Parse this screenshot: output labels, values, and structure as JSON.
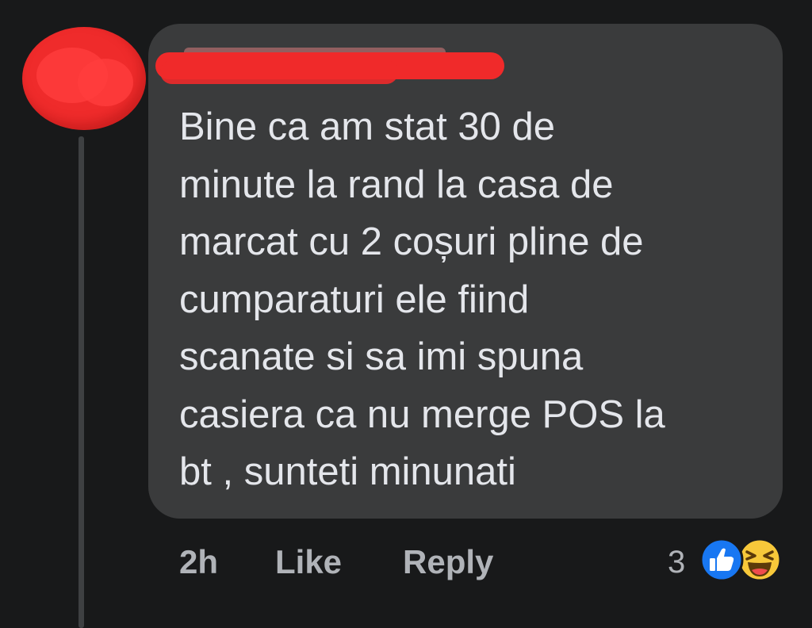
{
  "comment": {
    "author_name": "",
    "text": "Bine ca am stat 30 de\nminute la rand la casa de\nmarcat cu 2 coșuri pline de\ncumparaturi ele fiind\nscanate si sa imi spuna\ncasiera ca nu merge POS la\nbt , sunteti minunati",
    "timestamp": "2h",
    "like_label": "Like",
    "reply_label": "Reply",
    "reaction_count": "3",
    "reactions": [
      "like-icon",
      "haha-icon"
    ]
  },
  "colors": {
    "background": "#18191a",
    "bubble": "#3a3b3c",
    "text": "#e4e6eb",
    "secondary_text": "#b0b3b8",
    "redaction": "#f02a2a",
    "like_blue": "#1877f2",
    "haha_yellow": "#f7c83a"
  }
}
